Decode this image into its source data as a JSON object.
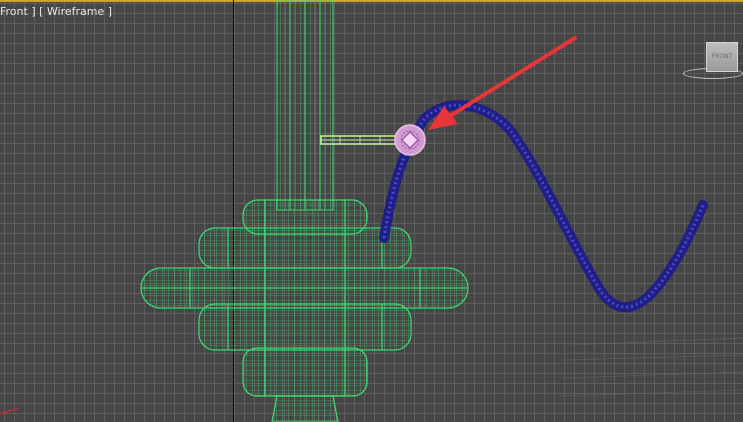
{
  "viewport": {
    "label": "Front ] [ Wireframe ]",
    "viewcube_label": "FRONT"
  },
  "colors": {
    "grid": "#5f5f5f",
    "background": "#464646",
    "wireframe_object": "#3ddc72",
    "spline": "#2b2b9c",
    "selected_bar": "#c8f0a0",
    "vertex_highlight": "#e6a8e6",
    "arrow": "#e8353a",
    "active_border": "#cfa52a"
  },
  "icons": [
    "viewcube",
    "red-arrow-pointer",
    "selected-vertex-marker"
  ]
}
